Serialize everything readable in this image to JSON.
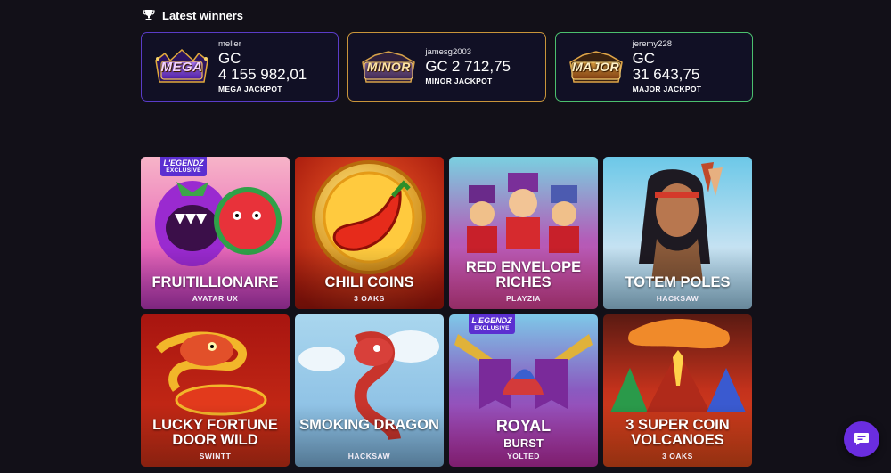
{
  "winners": {
    "heading": "Latest winners",
    "items": [
      {
        "badge": "MEGA",
        "user": "meller",
        "currency": "GC",
        "amount": "4 155 982,01",
        "label": "MEGA JACKPOT"
      },
      {
        "badge": "MINOR",
        "user": "jamesg2003",
        "currency": "GC",
        "amount": "2 712,75",
        "label": "MINOR JACKPOT"
      },
      {
        "badge": "MAJOR",
        "user": "jeremy228",
        "currency": "GC",
        "amount": "31 643,75",
        "label": "MAJOR JACKPOT"
      }
    ]
  },
  "exclusive_badge": {
    "brand": "L'EGENDZ",
    "sub": "EXCLUSIVE"
  },
  "games": [
    {
      "title": "FRUITILLIONAIRE",
      "provider": "AVATAR UX"
    },
    {
      "title": "CHILI COINS",
      "provider": "3 OAKS"
    },
    {
      "title": "RED ENVELOPE RICHES",
      "provider": "PLAYZIA"
    },
    {
      "title": "TOTEM POLES",
      "provider": "HACKSAW"
    },
    {
      "title": "LUCKY FORTUNE DOOR WILD",
      "provider": "SWINTT"
    },
    {
      "title": "SMOKING DRAGON",
      "provider": "HACKSAW"
    },
    {
      "title": "ROYAL",
      "title2": "BURST",
      "provider": "YOLTED"
    },
    {
      "title": "3 SUPER COIN VOLCANOES",
      "provider": "3 OAKS"
    }
  ],
  "icons": {
    "heading": "trophy-icon",
    "chat": "chat-icon"
  },
  "colors": {
    "background": "#121018",
    "mega": "#5a3cc8",
    "minor": "#c9953a",
    "major": "#4bc06e",
    "accent": "#6a2de0"
  }
}
